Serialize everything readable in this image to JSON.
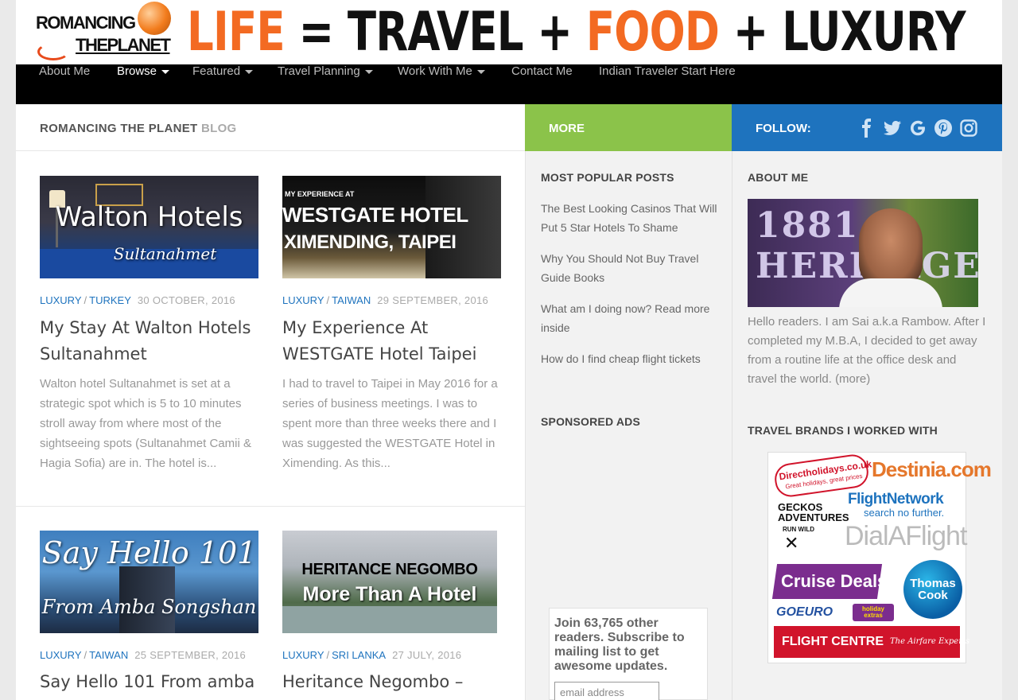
{
  "header": {
    "logo_line1": "ROMANCING",
    "logo_line2": "THEPLANET",
    "tag_life": "LIFE",
    "tag_eq": " = ",
    "tag_travel": "TRAVEL",
    "tag_plus1": " + ",
    "tag_food": "FOOD",
    "tag_plus2": " + ",
    "tag_luxury": "LUXURY"
  },
  "nav": {
    "items": [
      {
        "label": "About Me"
      },
      {
        "label": "Browse"
      },
      {
        "label": "Featured"
      },
      {
        "label": "Travel Planning"
      },
      {
        "label": "Work With Me"
      },
      {
        "label": "Contact Me"
      },
      {
        "label": "Indian Traveler Start Here"
      }
    ]
  },
  "subheader": {
    "blog_title_bold": "ROMANCING THE PLANET",
    "blog_title_light": "BLOG",
    "more_label": "MORE",
    "follow_label": "FOLLOW:",
    "social_icons": [
      "facebook-icon",
      "twitter-icon",
      "google-icon",
      "pinterest-icon",
      "instagram-icon"
    ]
  },
  "posts": [
    {
      "thumb_line1": "Walton Hotels",
      "thumb_line2": "Sultanahmet",
      "cat1": "LUXURY",
      "cat2": "TURKEY",
      "date": "30 OCTOBER, 2016",
      "title": "My Stay At Walton Hotels Sultanahmet",
      "excerpt": "Walton hotel Sultanahmet is set at a strategic spot which is 5 to 10 minutes stroll away from where most of the sightseeing spots (Sultanahmet Camii & Hagia Sofia) are in. The hotel is..."
    },
    {
      "thumb_small": "MY EXPERIENCE AT",
      "thumb_line1": "WESTGATE HOTEL",
      "thumb_line2": "XIMENDING, TAIPEI",
      "cat1": "LUXURY",
      "cat2": "TAIWAN",
      "date": "29 SEPTEMBER, 2016",
      "title": "My Experience At WESTGATE Hotel Taipei",
      "excerpt": "I had to travel to Taipei in May 2016 for a series of business meetings. I was to spent more than three weeks there and I was suggested the WESTGATE Hotel in Ximending. As this..."
    },
    {
      "thumb_line1": "Say Hello 101",
      "thumb_line2": "From Amba Songshan",
      "cat1": "LUXURY",
      "cat2": "TAIWAN",
      "date": "25 SEPTEMBER, 2016",
      "title": "Say Hello 101 From amba"
    },
    {
      "thumb_line1": "HERITANCE NEGOMBO",
      "thumb_line2": "More Than A Hotel",
      "cat1": "LUXURY",
      "cat2": "SRI LANKA",
      "date": "27 JULY, 2016",
      "title": "Heritance Negombo –"
    }
  ],
  "sidebar": {
    "popular_title": "MOST POPULAR POSTS",
    "popular": [
      "The Best Looking Casinos That Will Put 5 Star Hotels To Shame",
      "Why You Should Not Buy Travel Guide Books",
      "What am I doing now? Read more inside",
      "How do I find cheap flight tickets"
    ],
    "sponsored_title": "SPONSORED ADS",
    "subscribe_text": "Join 63,765 other readers. Subscribe to mailing list to get awesome updates.",
    "email_placeholder": "email address",
    "about_title": "ABOUT ME",
    "about_img_text": "1881 HERITAGE",
    "about_text": "Hello readers. I am Sai a.k.a Rambow. After I completed my M.B.A, I decided to get away from a routine life at the office desk and travel the world.",
    "about_more": "(more)",
    "brands_title": "TRAVEL BRANDS I WORKED WITH",
    "brands": {
      "directholidays": "Directholidays.co.uk",
      "directholidays_tag": "Great holidays, great prices",
      "destinia": "Destinia.com",
      "geckos": "GECKOS ADVENTURES",
      "geckos_tag": "RUN WILD",
      "flightnetwork": "FlightNetwork",
      "flightnetwork_tag": "search no further.",
      "dialaflight": "DialAFlight",
      "cruisedeals": "Cruise Deals",
      "thomascook": "Thomas Cook",
      "goeuro": "GOEURO",
      "holidayextras": "holiday extras",
      "flightcentre": "FLIGHT CENTRE",
      "flightcentre_tag": "The Airfare Experts"
    }
  },
  "colors": {
    "accent_blue": "#1e73be",
    "more_green": "#8bc34a",
    "logo_orange": "#f36a22",
    "nav_bg": "#000000"
  }
}
